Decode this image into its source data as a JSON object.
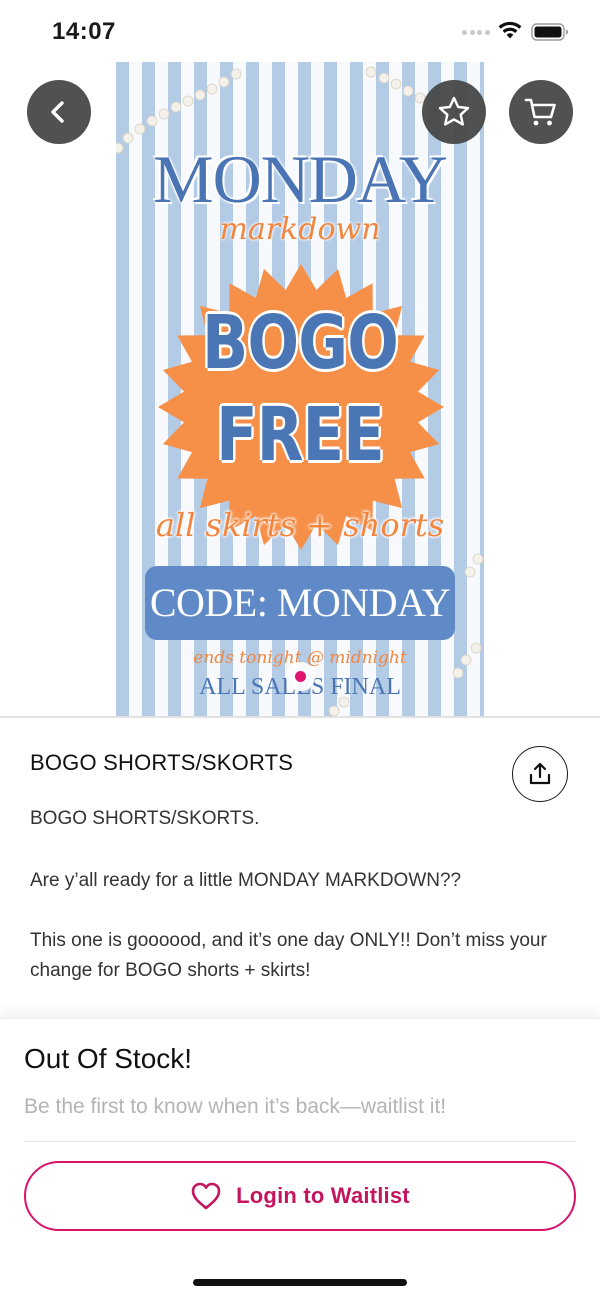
{
  "status_bar": {
    "time": "14:07"
  },
  "hero": {
    "poster": {
      "title": "MONDAY",
      "subtitle": "markdown",
      "burst_line1": "BOGO",
      "burst_line2": "FREE",
      "tagline": "all skirts + shorts",
      "code": "CODE: MONDAY",
      "ends": "ends tonight @ midnight",
      "final": "ALL SALES FINAL"
    },
    "pagination": {
      "current": 1,
      "total": 1
    }
  },
  "nav": {
    "back_icon": "chevron-left-icon",
    "favorite_icon": "star-icon",
    "cart_icon": "cart-icon"
  },
  "product": {
    "title": "BOGO SHORTS/SKORTS",
    "share_icon": "share-icon",
    "description": [
      "BOGO SHORTS/SKORTS.",
      "Are y’all ready for a little MONDAY MARKDOWN??",
      "This one is goooood, and it’s one day ONLY!! Don’t miss your change for BOGO shorts + skirts!"
    ]
  },
  "waitlist": {
    "title": "Out Of Stock!",
    "subtitle": "Be the first to know when it’s back—waitlist it!",
    "button_label": "Login to Waitlist",
    "button_icon": "heart-icon"
  },
  "colors": {
    "accent": "#d8136c",
    "poster_blue": "#4a74b4",
    "poster_orange": "#f2863f"
  }
}
